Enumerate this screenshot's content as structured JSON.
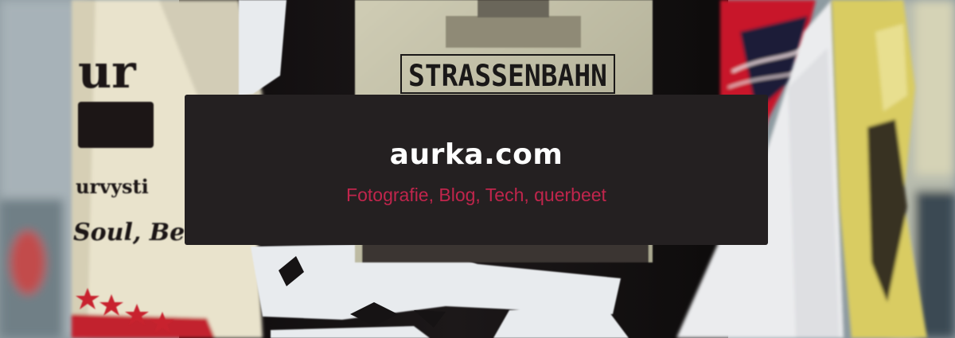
{
  "site": {
    "title": "aurka.com",
    "tagline": "Fotografie, Blog, Tech, querbeet"
  },
  "hero_image": {
    "sign_text": "STRASSENBAHN",
    "poster_text_top": "ur",
    "poster_text_mid": "urvysti",
    "poster_text_low": "Soul, Be"
  },
  "colors": {
    "title": "#ffffff",
    "tagline": "#c0254c",
    "card": "#242021"
  }
}
